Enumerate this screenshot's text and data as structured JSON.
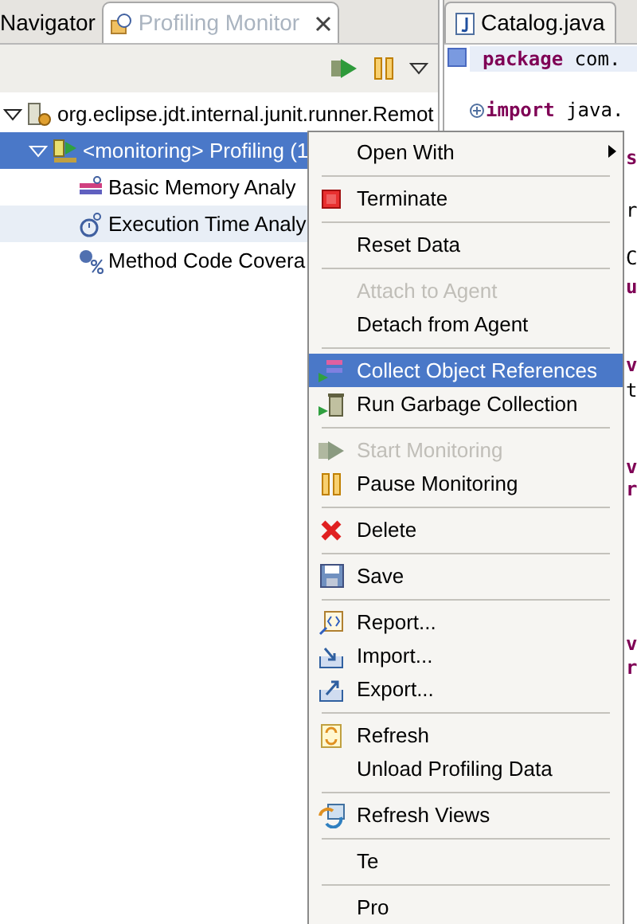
{
  "left_panel": {
    "tabs": [
      {
        "label": "Navigator",
        "selected": false
      },
      {
        "label": "Profiling Monitor",
        "selected": true
      }
    ],
    "tree": [
      {
        "label": "org.eclipse.jdt.internal.junit.runner.Remot",
        "expanded": true,
        "selected": false,
        "children": [
          {
            "label": "<monitoring> Profiling (1",
            "expanded": true,
            "selected": true,
            "children": [
              {
                "label": "Basic Memory Analy",
                "selected": false,
                "hover": false
              },
              {
                "label": "Execution Time Analy",
                "selected": false,
                "hover": true
              },
              {
                "label": "Method Code Covera",
                "selected": false,
                "hover": false
              }
            ]
          }
        ]
      }
    ]
  },
  "editor": {
    "tab": "Catalog.java",
    "lines": [
      {
        "kind": "keyword",
        "keyword": "package",
        "text": " com."
      },
      {
        "kind": "blank"
      },
      {
        "kind": "import",
        "keyword": "import",
        "text": " java."
      }
    ],
    "fragments": [
      {
        "text": "s",
        "keyword": true
      },
      {
        "text": "r",
        "keyword": false
      },
      {
        "text": "C",
        "keyword": false
      },
      {
        "text": "u",
        "keyword": true
      },
      {
        "text": "v",
        "keyword": true
      },
      {
        "text": "t",
        "keyword": false
      },
      {
        "text": "v",
        "keyword": true
      },
      {
        "text": "r",
        "keyword": true
      },
      {
        "text": "v",
        "keyword": true
      },
      {
        "text": "r",
        "keyword": true
      }
    ]
  },
  "context_menu": [
    {
      "kind": "item",
      "label": "Open With",
      "submenu": true,
      "disabled": false,
      "selected": false
    },
    {
      "kind": "separator"
    },
    {
      "kind": "item",
      "label": "Terminate",
      "disabled": false,
      "selected": false
    },
    {
      "kind": "separator"
    },
    {
      "kind": "item",
      "label": "Reset Data",
      "disabled": false,
      "selected": false
    },
    {
      "kind": "separator"
    },
    {
      "kind": "item",
      "label": "Attach to Agent",
      "disabled": true,
      "selected": false
    },
    {
      "kind": "item",
      "label": "Detach from Agent",
      "disabled": false,
      "selected": false
    },
    {
      "kind": "separator"
    },
    {
      "kind": "item",
      "label": "Collect Object References",
      "disabled": false,
      "selected": true
    },
    {
      "kind": "item",
      "label": "Run Garbage Collection",
      "disabled": false,
      "selected": false
    },
    {
      "kind": "separator"
    },
    {
      "kind": "item",
      "label": "Start Monitoring",
      "disabled": true,
      "selected": false
    },
    {
      "kind": "item",
      "label": "Pause Monitoring",
      "disabled": false,
      "selected": false
    },
    {
      "kind": "separator"
    },
    {
      "kind": "item",
      "label": "Delete",
      "disabled": false,
      "selected": false
    },
    {
      "kind": "separator"
    },
    {
      "kind": "item",
      "label": "Save",
      "disabled": false,
      "selected": false
    },
    {
      "kind": "separator"
    },
    {
      "kind": "item",
      "label": "Report...",
      "disabled": false,
      "selected": false
    },
    {
      "kind": "item",
      "label": "Import...",
      "disabled": false,
      "selected": false
    },
    {
      "kind": "item",
      "label": "Export...",
      "disabled": false,
      "selected": false
    },
    {
      "kind": "separator"
    },
    {
      "kind": "item",
      "label": "Refresh",
      "disabled": false,
      "selected": false
    },
    {
      "kind": "item",
      "label": "Unload Profiling Data",
      "disabled": false,
      "selected": false
    },
    {
      "kind": "separator"
    },
    {
      "kind": "item",
      "label": "Refresh Views",
      "disabled": false,
      "selected": false
    },
    {
      "kind": "separator"
    },
    {
      "kind": "item",
      "label": "Te",
      "disabled": false,
      "selected": false
    },
    {
      "kind": "separator"
    },
    {
      "kind": "item",
      "label": "Pro",
      "disabled": false,
      "selected": false
    }
  ]
}
